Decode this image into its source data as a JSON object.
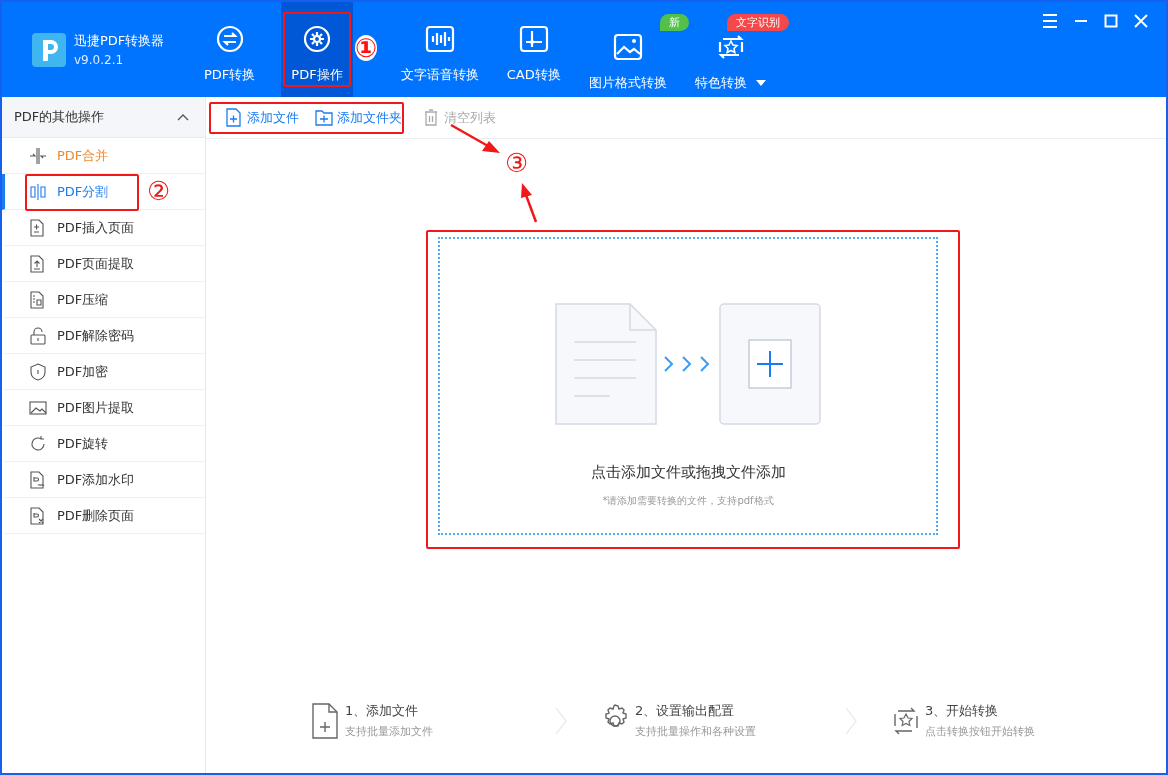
{
  "app": {
    "name": "迅捷PDF转换器",
    "version": "v9.0.2.1"
  },
  "nav_tabs": [
    {
      "label": "PDF转换",
      "selected": false
    },
    {
      "label": "PDF操作",
      "selected": true,
      "highlighted": true,
      "annotation": "①"
    },
    {
      "label": "文字语音转换",
      "selected": false
    },
    {
      "label": "CAD转换",
      "selected": false
    },
    {
      "label": "图片格式转换",
      "selected": false,
      "badge": "新",
      "color": "#52c14a"
    },
    {
      "label": "特色转换",
      "selected": false,
      "badge": "文字识别",
      "color": "#f5484a",
      "dropdown": true
    }
  ],
  "sidebar": {
    "title": "PDF的其他操作",
    "expanded": true,
    "items": [
      {
        "label": "PDF合并",
        "selected": false,
        "hot": true
      },
      {
        "label": "PDF分割",
        "selected": true,
        "hot": false,
        "highlighted": true,
        "annotation": "②"
      },
      {
        "label": "PDF插入页面",
        "selected": false,
        "hot": false
      },
      {
        "label": "PDF页面提取",
        "selected": false,
        "hot": false
      },
      {
        "label": "PDF压缩",
        "selected": false,
        "hot": false
      },
      {
        "label": "PDF解除密码",
        "selected": false,
        "hot": false
      },
      {
        "label": "PDF加密",
        "selected": false,
        "hot": false
      },
      {
        "label": "PDF图片提取",
        "selected": false,
        "hot": false
      },
      {
        "label": "PDF旋转",
        "selected": false,
        "hot": false
      },
      {
        "label": "PDF添加水印",
        "selected": false,
        "hot": false
      },
      {
        "label": "PDF删除页面",
        "selected": false,
        "hot": false
      }
    ]
  },
  "toolbar": {
    "annotation": "③",
    "buttons": [
      {
        "label": "添加文件",
        "disabled": false,
        "highlighted": true
      },
      {
        "label": "添加文件夹",
        "disabled": false,
        "highlighted": true
      },
      {
        "label": "清空列表",
        "disabled": true,
        "highlighted": false
      }
    ]
  },
  "dropzone": {
    "title": "点击添加文件或拖拽文件添加",
    "hint": "*请添加需要转换的文件，支持pdf格式",
    "highlighted": true
  },
  "steps": [
    {
      "title": "1、添加文件",
      "subtitle": "支持批量添加文件"
    },
    {
      "title": "2、设置输出配置",
      "subtitle": "支持批量操作和各种设置"
    },
    {
      "title": "3、开始转换",
      "subtitle": "点击转换按钮开始转换"
    }
  ]
}
